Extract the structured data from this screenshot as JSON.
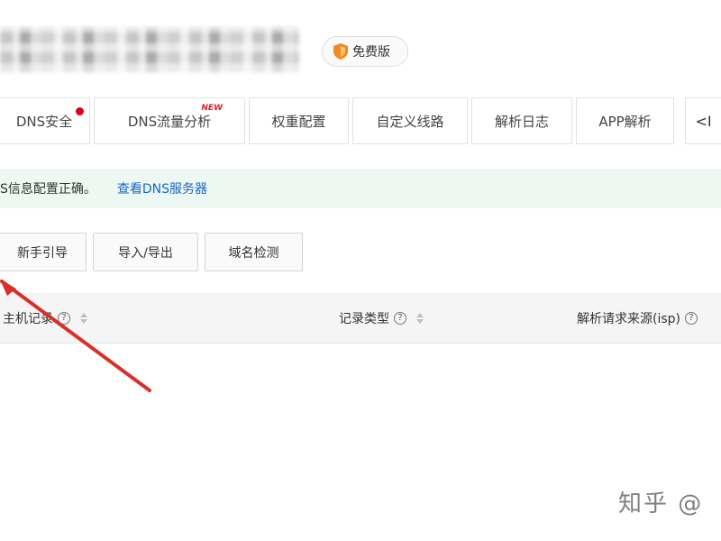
{
  "header": {
    "edition_label": "免费版"
  },
  "tabs": [
    {
      "label": "DNS安全",
      "has_dot": true
    },
    {
      "label": "DNS流量分析",
      "badge": "NEW"
    },
    {
      "label": "权重配置"
    },
    {
      "label": "自定义线路"
    },
    {
      "label": "解析日志"
    },
    {
      "label": "APP解析"
    }
  ],
  "tab_scroll_label": "<I",
  "notice": {
    "message": "S信息配置正确。",
    "link": "查看DNS服务器"
  },
  "toolbar": {
    "guide_label": "新手引导",
    "import_export_label": "导入/导出",
    "domain_check_label": "域名检测"
  },
  "table": {
    "columns": [
      {
        "label": "主机记录",
        "help": "?"
      },
      {
        "label": "记录类型",
        "help": "?"
      },
      {
        "label": "解析请求来源(isp)",
        "help": "?"
      }
    ]
  },
  "watermark": "知乎 @"
}
